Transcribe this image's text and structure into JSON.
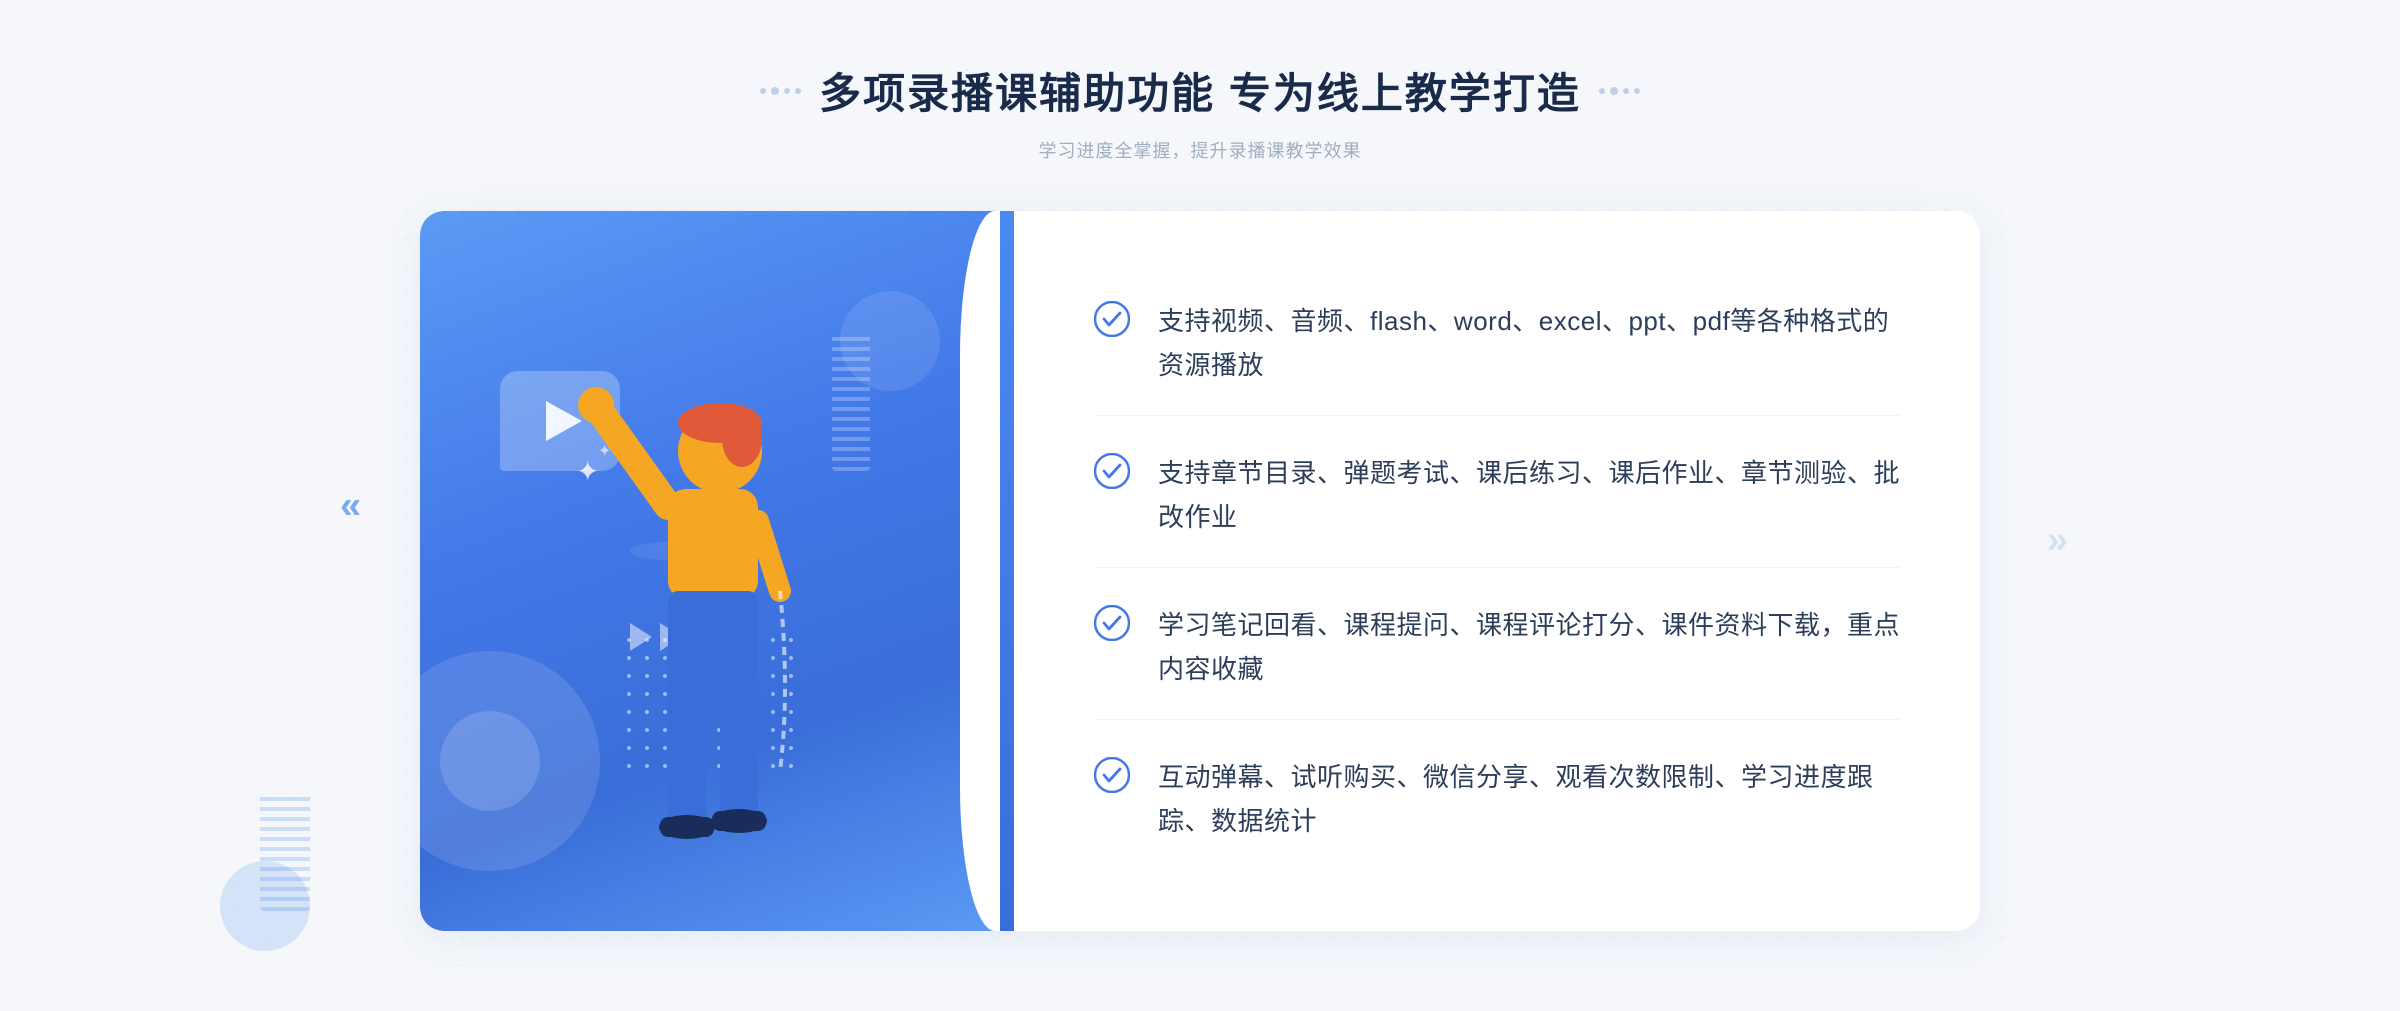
{
  "header": {
    "title": "多项录播课辅助功能 专为线上教学打造",
    "subtitle": "学习进度全掌握，提升录播课教学效果",
    "deco_left": [
      "●",
      "●",
      "●"
    ],
    "deco_right": [
      "●",
      "●",
      "●"
    ]
  },
  "features": [
    {
      "id": 1,
      "text": "支持视频、音频、flash、word、excel、ppt、pdf等各种格式的资源播放"
    },
    {
      "id": 2,
      "text": "支持章节目录、弹题考试、课后练习、课后作业、章节测验、批改作业"
    },
    {
      "id": 3,
      "text": "学习笔记回看、课程提问、课程评论打分、课件资料下载，重点内容收藏"
    },
    {
      "id": 4,
      "text": "互动弹幕、试听购买、微信分享、观看次数限制、学习进度跟踪、数据统计"
    }
  ],
  "colors": {
    "accent_blue": "#4278e8",
    "light_blue": "#5b9af5",
    "text_dark": "#2c3e5a",
    "text_gray": "#a0afc0",
    "text_heading": "#1a2a4a",
    "check_color": "#4278e8"
  }
}
